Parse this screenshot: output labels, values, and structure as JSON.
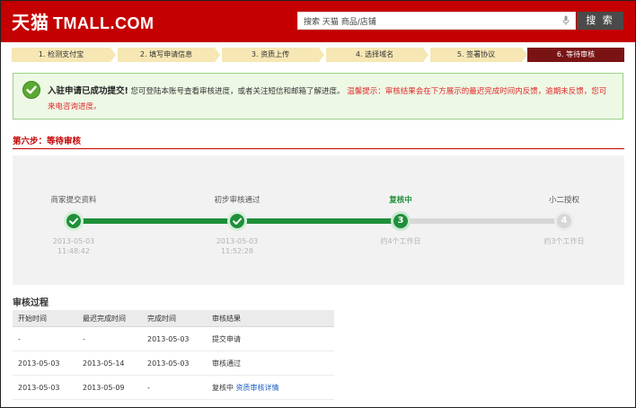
{
  "header": {
    "logo_cn": "天猫",
    "logo_en": "TMALL.COM",
    "search_value": "搜索 天猫 商品/店铺",
    "search_button": "搜 索",
    "mic_icon": "microphone-icon",
    "brand_color": "#c40000"
  },
  "steps": [
    {
      "label": "1. 检测支付宝",
      "state": "done"
    },
    {
      "label": "2. 填写申请信息",
      "state": "done"
    },
    {
      "label": "3. 资质上传",
      "state": "done"
    },
    {
      "label": "4. 选择域名",
      "state": "done"
    },
    {
      "label": "5. 签署协议",
      "state": "done"
    },
    {
      "label": "6. 等待审核",
      "state": "active"
    }
  ],
  "success": {
    "icon": "checkmark-icon",
    "title": "入驻申请已成功提交!",
    "body": "您可登陆本账号查看审核进度，或者关注短信和邮箱了解进度。",
    "warning": "温馨提示：审核结果会在下方展示的最迟完成时间内反馈，逾期未反馈，您可来电咨询进度。"
  },
  "section": {
    "title": "第六步：等待审核"
  },
  "progress": {
    "stages": [
      {
        "label": "商家提交资料",
        "status": "done",
        "time": "2013-05-03",
        "time2": "11:48:42"
      },
      {
        "label": "初步审核通过",
        "status": "done",
        "time": "2013-05-03",
        "time2": "11:52:28"
      },
      {
        "label": "复核中",
        "status": "current",
        "number": "3",
        "time": "约4个工作日",
        "time2": ""
      },
      {
        "label": "小二授权",
        "status": "todo",
        "number": "4",
        "time": "约3个工作日",
        "time2": ""
      }
    ],
    "colors": {
      "done": "#1f8f3a",
      "todo": "#d7d7d7"
    }
  },
  "audit": {
    "title": "审核过程",
    "columns": [
      "开始时间",
      "最迟完成时间",
      "完成时间",
      "审核结果"
    ],
    "rows": [
      {
        "start": "-",
        "deadline": "-",
        "done": "2013-05-03",
        "result": "提交申请",
        "link": ""
      },
      {
        "start": "2013-05-03",
        "deadline": "2013-05-14",
        "done": "2013-05-03",
        "result": "审核通过",
        "link": ""
      },
      {
        "start": "2013-05-03",
        "deadline": "2013-05-09",
        "done": "-",
        "result": "复核中",
        "link": "资质审核详情"
      }
    ]
  }
}
